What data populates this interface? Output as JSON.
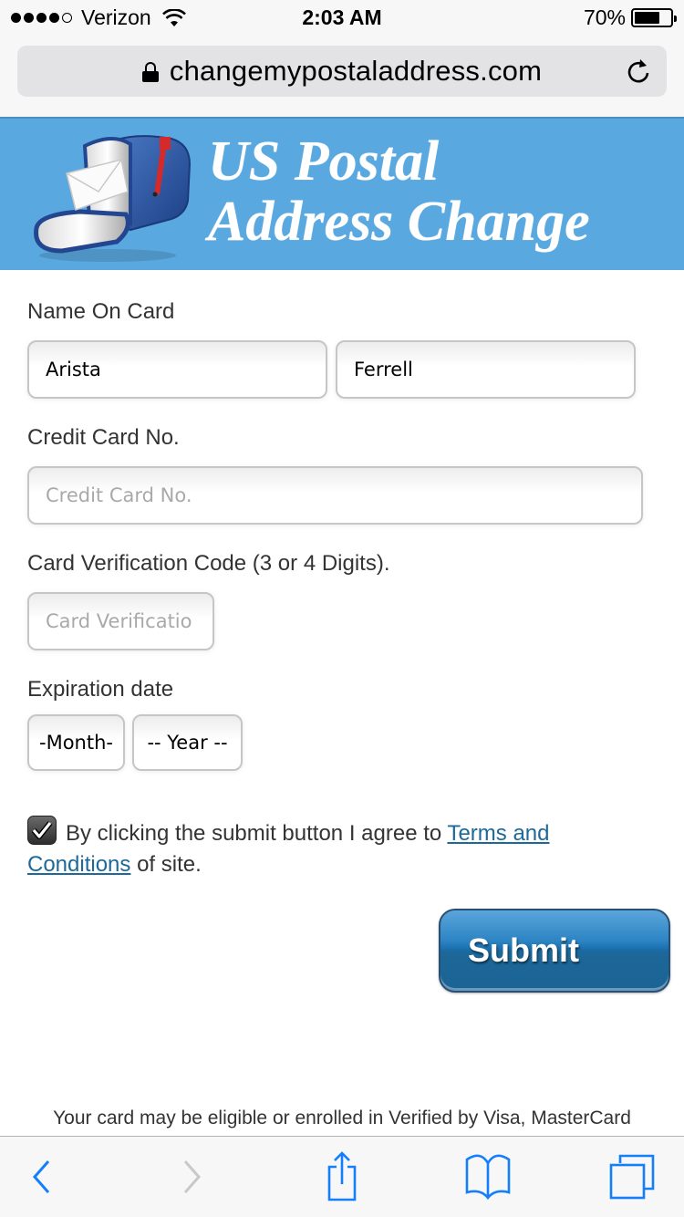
{
  "status_bar": {
    "signal_bars_filled": 4,
    "signal_bars_total": 5,
    "carrier": "Verizon",
    "time": "2:03 AM",
    "battery_percent_label": "70%",
    "battery_level": 0.7
  },
  "browser": {
    "url": "changemypostaladdress.com",
    "secure": true,
    "icons": {
      "lock": "lock-icon",
      "reload": "reload-icon"
    }
  },
  "banner": {
    "title_line1": "US Postal",
    "title_line2": "Address Change",
    "logo": "mailbox-icon"
  },
  "form": {
    "name_on_card": {
      "label": "Name On Card",
      "first_name_value": "Arista",
      "last_name_value": "Ferrell"
    },
    "credit_card": {
      "label": "Credit Card No.",
      "placeholder": "Credit Card No.",
      "value": ""
    },
    "cvc": {
      "label": "Card Verification Code (3 or 4 Digits).",
      "placeholder": "Card Verificatio",
      "value": ""
    },
    "expiration": {
      "label": "Expiration date",
      "month_selected": "-Month-",
      "year_selected": "-- Year --"
    },
    "agreement": {
      "checked": true,
      "text_before": "By clicking the submit button I agree to ",
      "link_text_1": "Terms and",
      "link_text_2": "Conditions",
      "text_after": " of site."
    },
    "submit_label": "Submit"
  },
  "footer_note": "Your card may be eligible or enrolled in Verified by Visa, MasterCard",
  "toolbar": {
    "back": "back-icon",
    "forward": "forward-icon",
    "share": "share-icon",
    "bookmarks": "bookmarks-icon",
    "tabs": "tabs-icon"
  },
  "colors": {
    "banner_bg": "#59a8df",
    "link": "#1d6a9a",
    "ios_blue": "#157efb",
    "submit_blue": "#1c6899"
  }
}
